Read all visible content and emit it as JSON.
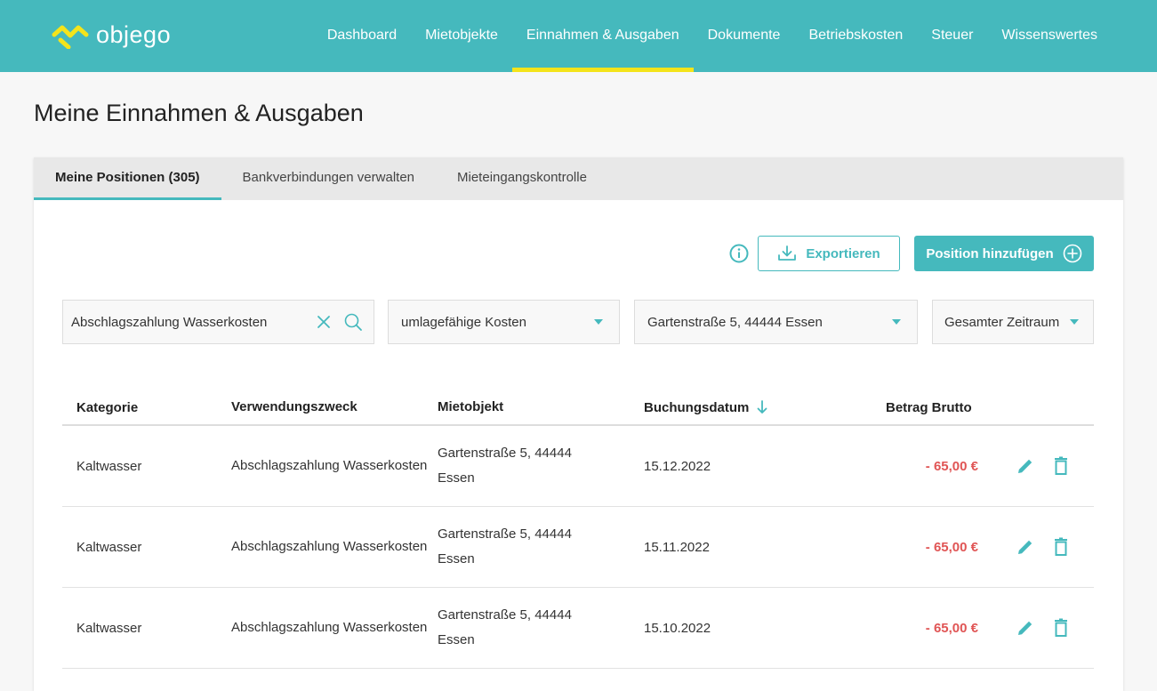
{
  "brand": {
    "name": "objego",
    "accent": "#45b9bd",
    "highlight": "#f4e41b"
  },
  "nav": {
    "items": [
      {
        "label": "Dashboard",
        "active": false
      },
      {
        "label": "Mietobjekte",
        "active": false
      },
      {
        "label": "Einnahmen & Ausgaben",
        "active": true
      },
      {
        "label": "Dokumente",
        "active": false
      },
      {
        "label": "Betriebskosten",
        "active": false
      },
      {
        "label": "Steuer",
        "active": false
      },
      {
        "label": "Wissenswertes",
        "active": false
      }
    ]
  },
  "page": {
    "title": "Meine Einnahmen & Ausgaben"
  },
  "tabs": [
    {
      "label": "Meine Positionen (305)",
      "active": true
    },
    {
      "label": "Bankverbindungen verwalten",
      "active": false
    },
    {
      "label": "Mieteingangskontrolle",
      "active": false
    }
  ],
  "actions": {
    "export_label": "Exportieren",
    "add_label": "Position hinzufügen"
  },
  "filters": {
    "search_value": "Abschlagszahlung Wasserkosten",
    "category": "umlagefähige Kosten",
    "property": "Gartenstraße 5, 44444 Essen",
    "period": "Gesamter Zeitraum"
  },
  "table": {
    "headers": {
      "category": "Kategorie",
      "purpose": "Verwendungszweck",
      "property": "Mietobjekt",
      "date": "Buchungsdatum",
      "amount": "Betrag Brutto"
    },
    "rows": [
      {
        "category": "Kaltwasser",
        "purpose": "Abschlagszahlung Wasserkosten",
        "property_line1": "Gartenstraße 5, 44444",
        "property_line2": "Essen",
        "date": "15.12.2022",
        "amount": "- 65,00 €"
      },
      {
        "category": "Kaltwasser",
        "purpose": "Abschlagszahlung Wasserkosten",
        "property_line1": "Gartenstraße 5, 44444",
        "property_line2": "Essen",
        "date": "15.11.2022",
        "amount": "- 65,00 €"
      },
      {
        "category": "Kaltwasser",
        "purpose": "Abschlagszahlung Wasserkosten",
        "property_line1": "Gartenstraße 5, 44444",
        "property_line2": "Essen",
        "date": "15.10.2022",
        "amount": "- 65,00 €"
      }
    ]
  }
}
